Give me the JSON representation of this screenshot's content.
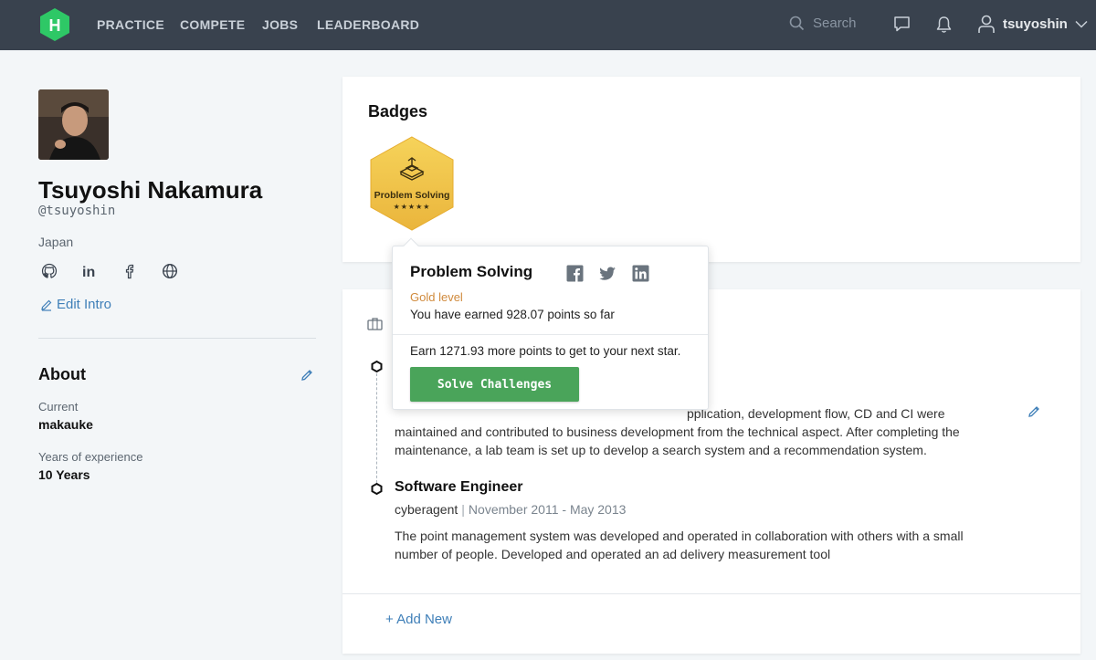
{
  "nav": {
    "links": [
      "PRACTICE",
      "COMPETE",
      "JOBS",
      "LEADERBOARD"
    ],
    "search_placeholder": "Search",
    "username": "tsuyoshin"
  },
  "profile": {
    "full_name": "Tsuyoshi Nakamura",
    "handle": "@tsuyoshin",
    "country": "Japan",
    "social_icons": [
      "github-icon",
      "linkedin-icon",
      "facebook-icon",
      "globe-icon"
    ],
    "edit_intro_label": "Edit Intro"
  },
  "about": {
    "title": "About",
    "current_label": "Current",
    "current_value": "makauke",
    "experience_label": "Years of experience",
    "experience_value": "10 Years"
  },
  "badges": {
    "title": "Badges",
    "items": [
      {
        "name": "Problem Solving",
        "stars_display": "★★★★★",
        "stars": 5,
        "color": "#f0c64a"
      }
    ]
  },
  "popover": {
    "title": "Problem Solving",
    "level": "Gold level",
    "earned_text": "You have earned 928.07 points so far",
    "next_text": "Earn 1271.93 more points to get to your next star.",
    "button_label": "Solve Challenges",
    "share_icons": [
      "facebook-icon",
      "twitter-icon",
      "linkedin-icon"
    ]
  },
  "work": {
    "entries": [
      {
        "desc_visible": "…pplication, development flow, CD and CI were maintained and contributed to business development from the technical aspect. After completing the maintenance, a lab team is set up to develop a search system and a recommendation system.",
        "desc_line1": "pplication, development flow, CD and CI were",
        "desc_line2": "maintained and contributed to business development from the technical aspect. After completing the",
        "desc_line3": "maintenance, a lab team is set up to develop a search system and a recommendation system."
      },
      {
        "title": "Software Engineer",
        "company": "cyberagent",
        "separator": "|",
        "dates": "November 2011 - May 2013",
        "desc_line1": "The point management system was developed and operated in collaboration with others with a small",
        "desc_line2": "number of people. Developed and operated an ad delivery measurement tool"
      }
    ],
    "add_new_label": "+ Add New"
  },
  "colors": {
    "nav_bg": "#39424e",
    "accent_green": "#4aa45a",
    "link_blue": "#3f7fb8",
    "gold": "#f0c64a",
    "level_orange": "#d08a3c"
  }
}
